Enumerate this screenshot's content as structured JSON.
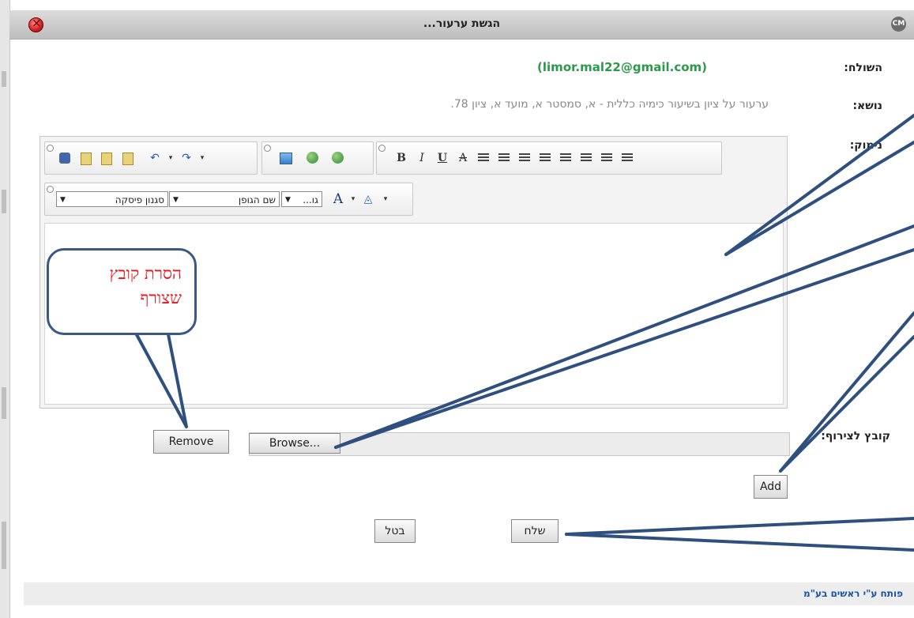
{
  "window": {
    "title": "הגשת ערעור..."
  },
  "form": {
    "sender_label": "השולח:",
    "sender_value": "(limor.mal22@gmail.com)",
    "subject_label": "נושא:",
    "subject_value": "ערעור על ציון בשיעור כימיה כללית - א, סמסטר א, מועד א, ציון 78.",
    "reason_label": "נימוק:",
    "attachment_label": "קובץ לצירוף:"
  },
  "editor": {
    "toolbar": {
      "paragraph_style": "סגנון פיסקה",
      "font_name": "שם הגופן",
      "font_size": "גו..."
    },
    "content": ""
  },
  "buttons": {
    "remove": "Remove",
    "browse": "Browse...",
    "add": "Add",
    "send": "שלח",
    "cancel": "בטל"
  },
  "callout": {
    "text_line1": "הסרת קובץ",
    "text_line2": "שצורף"
  },
  "footer": {
    "text": "פותח ע\"י ראשים בע\"מ"
  },
  "colors": {
    "sender": "#2a9a4a",
    "callout_text": "#e8141c",
    "arrow": "#2f4f7f",
    "footer_link": "#1a55a8"
  }
}
